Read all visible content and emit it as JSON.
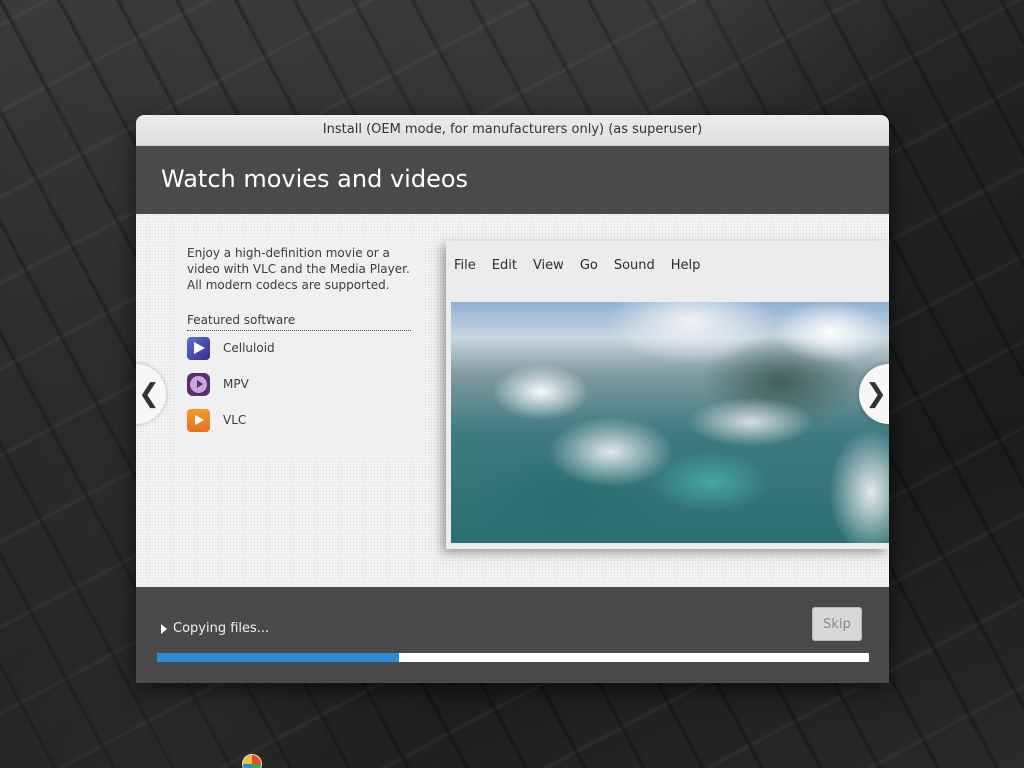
{
  "window": {
    "title": "Install (OEM mode, for manufacturers only) (as superuser)"
  },
  "slide": {
    "heading": "Watch movies and videos",
    "description": "Enjoy a high-definition movie or a video with VLC and the Media Player. All modern codecs are supported.",
    "featured_heading": "Featured software",
    "apps": [
      {
        "label": "Celluloid",
        "icon": "celluloid-icon"
      },
      {
        "label": "MPV",
        "icon": "mpv-icon"
      },
      {
        "label": "VLC",
        "icon": "vlc-icon"
      }
    ],
    "nav_prev": "❮",
    "nav_next": "❯"
  },
  "player_menu": [
    "File",
    "Edit",
    "View",
    "Go",
    "Sound",
    "Help"
  ],
  "footer": {
    "status": "Copying files...",
    "skip_label": "Skip",
    "progress_fraction": 0.34
  },
  "colors": {
    "accent": "#2a8ad4",
    "header_bg": "#4a4a4a"
  }
}
